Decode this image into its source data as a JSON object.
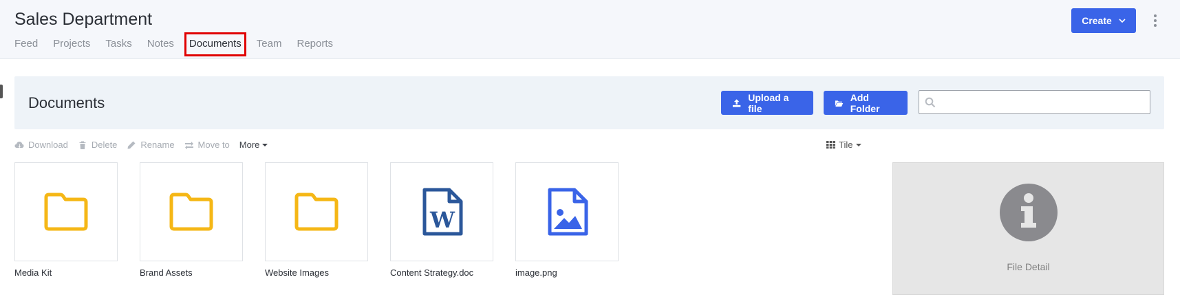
{
  "header": {
    "title": "Sales Department",
    "tabs": [
      {
        "label": "Feed"
      },
      {
        "label": "Projects"
      },
      {
        "label": "Tasks"
      },
      {
        "label": "Notes"
      },
      {
        "label": "Documents",
        "active": true
      },
      {
        "label": "Team"
      },
      {
        "label": "Reports"
      }
    ],
    "create_label": "Create",
    "accent_color": "#3a64e8",
    "highlight_color": "#e00000"
  },
  "panel": {
    "title": "Documents",
    "upload_label": "Upload a file",
    "add_folder_label": "Add Folder",
    "search_value": "",
    "search_placeholder": ""
  },
  "toolbar": {
    "download": "Download",
    "delete": "Delete",
    "rename": "Rename",
    "move_to": "Move to",
    "more": "More",
    "view": "Tile"
  },
  "files": [
    {
      "name": "Media Kit",
      "type": "folder-icon"
    },
    {
      "name": "Brand Assets",
      "type": "folder-icon"
    },
    {
      "name": "Website Images",
      "type": "folder-icon"
    },
    {
      "name": "Content Strategy.doc",
      "type": "word-doc-icon"
    },
    {
      "name": "image.png",
      "type": "image-file-icon"
    }
  ],
  "detail": {
    "label": "File Detail",
    "icon": "info-icon"
  }
}
